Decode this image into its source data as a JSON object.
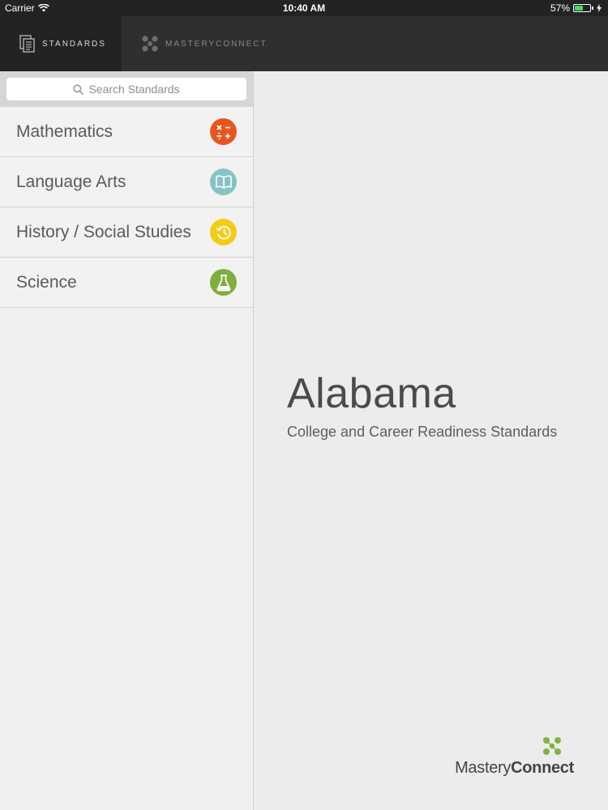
{
  "status_bar": {
    "carrier": "Carrier",
    "time": "10:40 AM",
    "battery": "57%",
    "battery_level": 0.57
  },
  "nav": {
    "tabs": [
      {
        "label": "STANDARDS",
        "icon": "document-stack-icon"
      },
      {
        "label": "MASTERYCONNECT",
        "icon": "masteryconnect-logo-icon"
      }
    ]
  },
  "search": {
    "placeholder": "Search Standards"
  },
  "subjects": [
    {
      "label": "Mathematics",
      "icon": "math-operators-icon",
      "color": "#e8551f"
    },
    {
      "label": "Language Arts",
      "icon": "open-book-icon",
      "color": "#86c3c6"
    },
    {
      "label": "History / Social Studies",
      "icon": "history-clock-icon",
      "color": "#f3cc18"
    },
    {
      "label": "Science",
      "icon": "flask-icon",
      "color": "#7fae3c"
    }
  ],
  "main": {
    "title": "Alabama",
    "subtitle": "College and Career Readiness Standards"
  },
  "brand": {
    "part1": "Mastery",
    "part2": "Connect",
    "accent": "#7fb342"
  }
}
